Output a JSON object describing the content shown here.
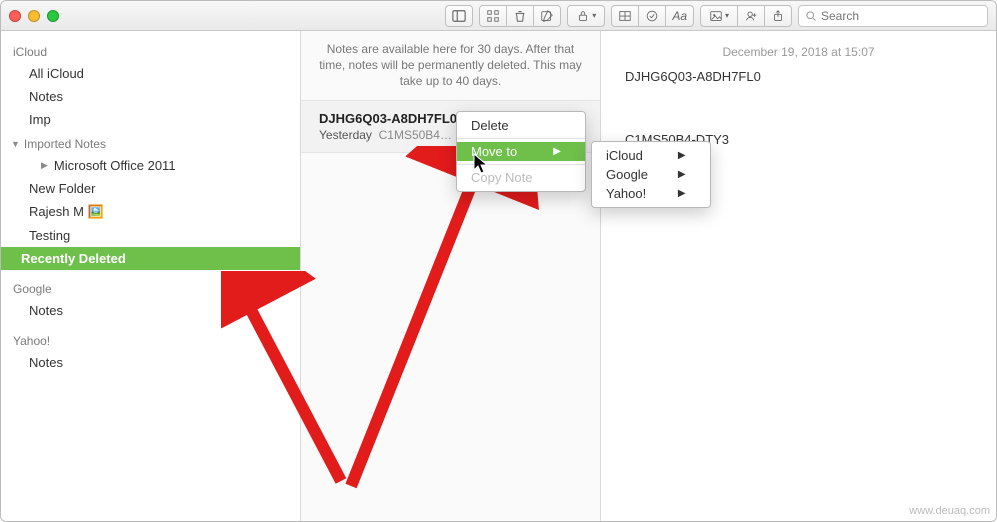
{
  "toolbar": {
    "search_placeholder": "Search"
  },
  "sidebar": {
    "sections": [
      {
        "title": "iCloud",
        "items": [
          {
            "label": "All iCloud"
          },
          {
            "label": "Notes"
          },
          {
            "label": "Imp"
          }
        ],
        "group": {
          "label": "Imported Notes",
          "children": [
            {
              "label": "Microsoft Office 2011"
            }
          ]
        },
        "more_items": [
          {
            "label": "New Folder"
          },
          {
            "label": "Rajesh M 🖼️"
          },
          {
            "label": "Testing"
          },
          {
            "label": "Recently Deleted",
            "selected": true
          }
        ]
      },
      {
        "title": "Google",
        "items": [
          {
            "label": "Notes"
          }
        ]
      },
      {
        "title": "Yahoo!",
        "items": [
          {
            "label": "Notes"
          }
        ]
      }
    ]
  },
  "list": {
    "banner": "Notes are available here for 30 days. After that time, notes will be permanently deleted. This may take up to 40 days.",
    "note": {
      "title": "DJHG6Q03-A8DH7FL0",
      "date": "Yesterday",
      "preview": "C1MS50B4…"
    }
  },
  "detail": {
    "date": "December 19, 2018 at 15:07",
    "title": "DJHG6Q03-A8DH7FL0",
    "body": "C1MS50B4-DTY3"
  },
  "menu1": {
    "items": [
      {
        "label": "Delete"
      },
      {
        "label": "Move to",
        "highlight": true,
        "submenu": true
      },
      {
        "label": "Copy Note"
      }
    ]
  },
  "menu2": {
    "items": [
      {
        "label": "iCloud",
        "submenu": true
      },
      {
        "label": "Google",
        "submenu": true
      },
      {
        "label": "Yahoo!",
        "submenu": true
      }
    ]
  },
  "watermark": "www.deuaq.com"
}
